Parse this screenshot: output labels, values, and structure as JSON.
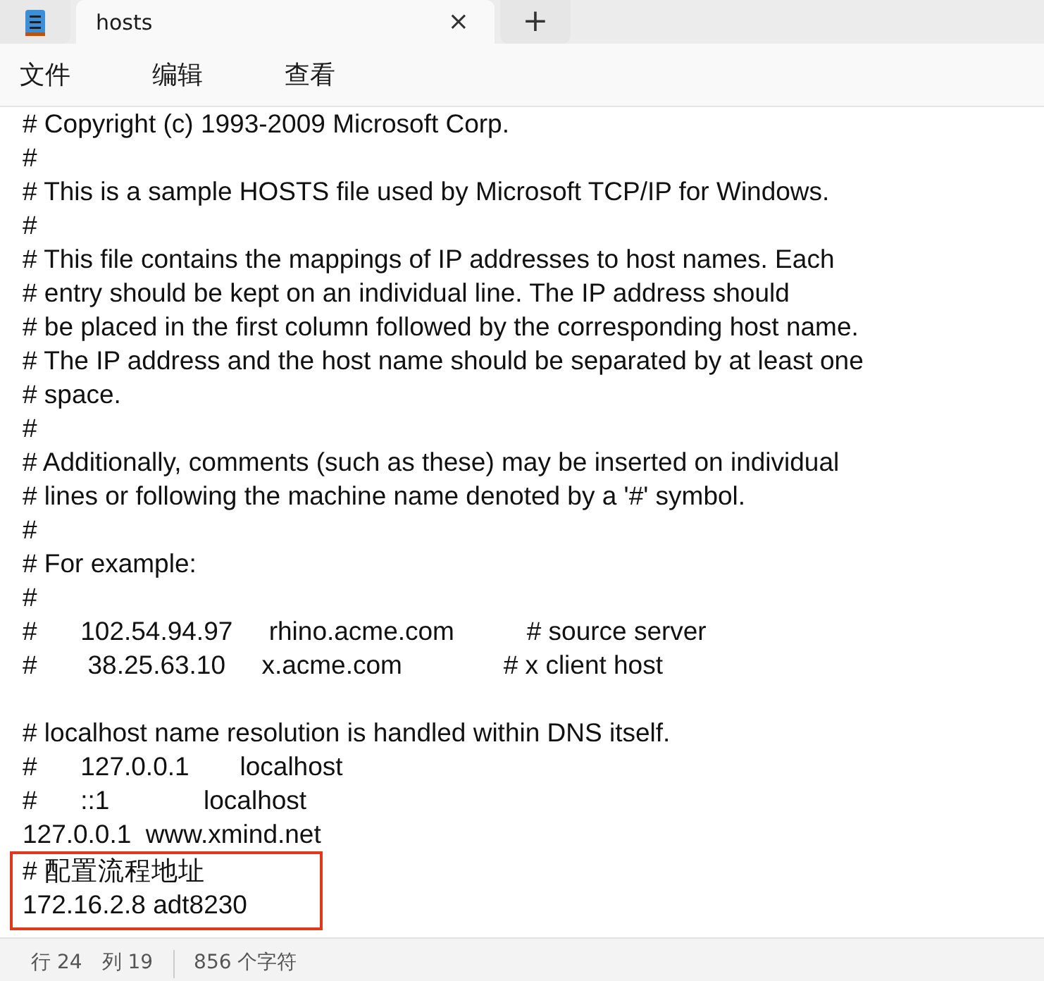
{
  "tab": {
    "title": "hosts",
    "selected": true,
    "close_glyph": "×"
  },
  "new_tab_glyph": "+",
  "menu": [
    "文件",
    "编辑",
    "查看"
  ],
  "lines": [
    {
      "text": "# Copyright (c) 1993-2009 Microsoft Corp.",
      "highlighted": false
    },
    {
      "text": "#",
      "highlighted": false
    },
    {
      "text": "# This is a sample HOSTS file used by Microsoft TCP/IP for Windows.",
      "highlighted": false
    },
    {
      "text": "#",
      "highlighted": false
    },
    {
      "text": "# This file contains the mappings of IP addresses to host names. Each",
      "highlighted": false
    },
    {
      "text": "# entry should be kept on an individual line. The IP address should",
      "highlighted": false
    },
    {
      "text": "# be placed in the first column followed by the corresponding host name.",
      "highlighted": false
    },
    {
      "text": "# The IP address and the host name should be separated by at least one",
      "highlighted": false
    },
    {
      "text": "# space.",
      "highlighted": false
    },
    {
      "text": "#",
      "highlighted": false
    },
    {
      "text": "# Additionally, comments (such as these) may be inserted on individual",
      "highlighted": false
    },
    {
      "text": "# lines or following the machine name denoted by a '#' symbol.",
      "highlighted": false
    },
    {
      "text": "#",
      "highlighted": false
    },
    {
      "text": "# For example:",
      "highlighted": false
    },
    {
      "text": "#",
      "highlighted": false
    },
    {
      "text": "#      102.54.94.97     rhino.acme.com          # source server",
      "highlighted": false
    },
    {
      "text": "#       38.25.63.10     x.acme.com              # x client host",
      "highlighted": false
    },
    {
      "highlighted": false
    },
    {
      "text": "# localhost name resolution is handled within DNS itself.",
      "highlighted": false
    },
    {
      "text": "#      127.0.0.1       localhost",
      "highlighted": false
    },
    {
      "text": "#      ::1             localhost",
      "highlighted": false
    },
    {
      "text": "127.0.0.1  www.xmind.net",
      "highlighted": false
    },
    {
      "text": "# 配置流程地址",
      "highlighted": true
    },
    {
      "text": "172.16.2.8 adt8230",
      "highlighted": true
    }
  ],
  "status_bar": {
    "line": "行 24",
    "column": "列 19",
    "characters": "856 个字符"
  }
}
